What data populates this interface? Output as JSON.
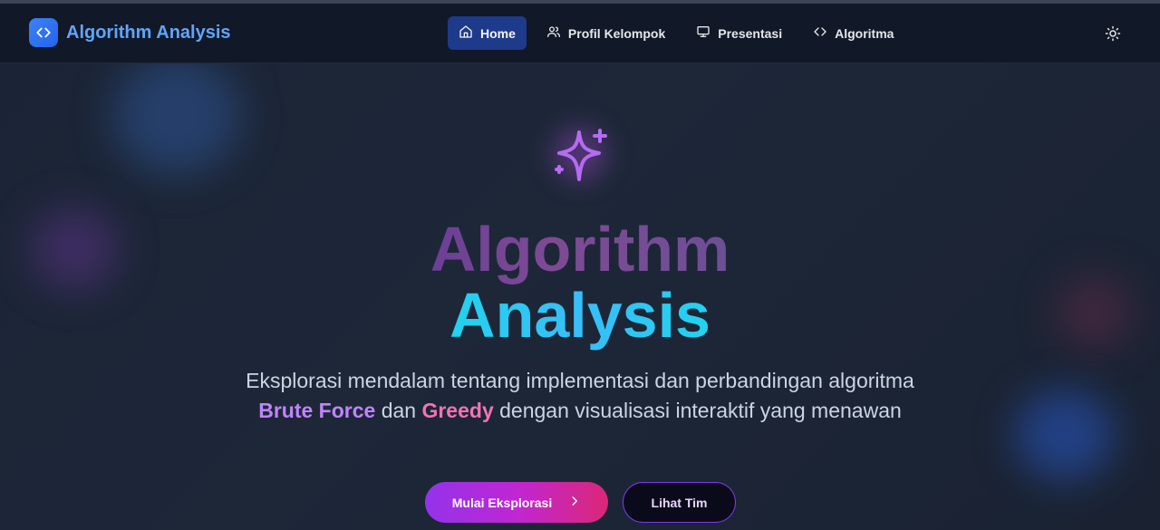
{
  "app": {
    "title": "Algorithm Analysis"
  },
  "nav": {
    "items": [
      {
        "label": "Home",
        "icon": "home-icon",
        "active": true
      },
      {
        "label": "Profil Kelompok",
        "icon": "users-icon",
        "active": false
      },
      {
        "label": "Presentasi",
        "icon": "monitor-icon",
        "active": false
      },
      {
        "label": "Algoritma",
        "icon": "code-icon",
        "active": false
      }
    ],
    "theme_toggle_icon": "sun-icon"
  },
  "hero": {
    "icon": "sparkles-icon",
    "title_line1": "Algorithm",
    "title_line2": "Analysis",
    "description": {
      "part1": "Eksplorasi mendalam tentang implementasi dan perbandingan algoritma ",
      "highlight1": "Brute Force",
      "part2": " dan ",
      "highlight2": "Greedy",
      "part3": " dengan visualisasi interaktif yang menawan"
    },
    "primary_button": "Mulai Eksplorasi",
    "secondary_button": "Lihat Tim"
  },
  "colors": {
    "brand": "#3b82f6",
    "nav_active": "#1e3a8a",
    "accent_purple": "#c084fc",
    "accent_pink": "#f472b6",
    "title_cyan": "#22d3ee"
  }
}
